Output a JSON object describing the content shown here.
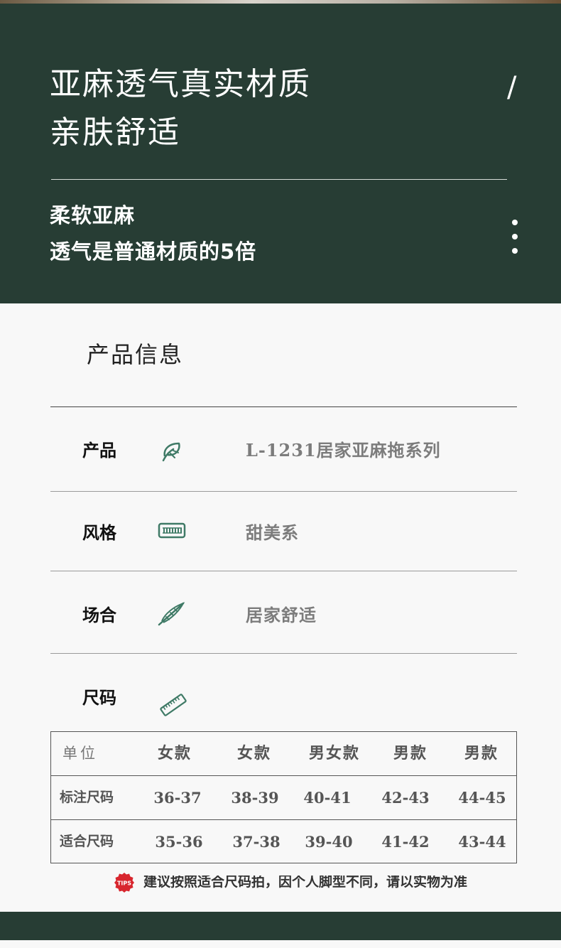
{
  "hero": {
    "title_line1": "亚麻透气真实材质",
    "title_line2": "亲肤舒适",
    "slash": "/",
    "sub_line1": "柔软亚麻",
    "sub_line2": "透气是普通材质的5倍"
  },
  "info": {
    "section_title": "产品信息",
    "rows": [
      {
        "label": "产品",
        "icon": "leaf-icon",
        "value": "L-1231居家亚麻拖系列"
      },
      {
        "label": "风格",
        "icon": "keyboard-icon",
        "value": "甜美系"
      },
      {
        "label": "场合",
        "icon": "feather-icon",
        "value": "居家舒适"
      },
      {
        "label": "尺码",
        "icon": "ruler-icon",
        "value": ""
      }
    ]
  },
  "size_table": {
    "header": [
      "单位",
      "女款",
      "女款",
      "男女款",
      "男款",
      "男款"
    ],
    "rows": [
      [
        "标注尺码",
        "36-37",
        "38-39",
        "40-41",
        "42-43",
        "44-45"
      ],
      [
        "适合尺码",
        "35-36",
        "37-38",
        "39-40",
        "41-42",
        "43-44"
      ]
    ]
  },
  "tips": {
    "badge": "TIPS",
    "text": "建议按照适合尺码拍，因个人脚型不同，请以实物为准"
  },
  "colors": {
    "hero_bg": "#273d34",
    "icon_color": "#3f7a66",
    "badge_red": "#d8262e"
  }
}
